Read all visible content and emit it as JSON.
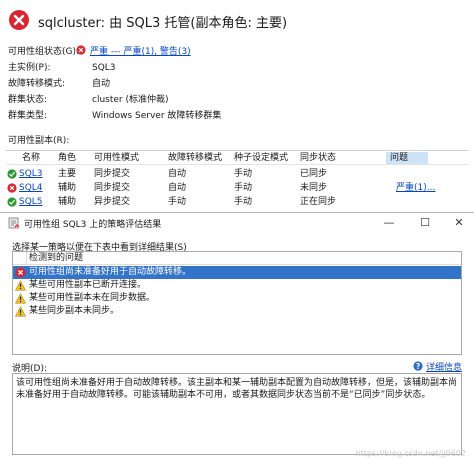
{
  "header": {
    "title": "sqlcluster: 由 SQL3 托管(副本角色: 主要)",
    "icon": "error-icon"
  },
  "properties": [
    {
      "label": "可用性组状态(G):",
      "value": "严重 --- 严重(1), 警告(3)",
      "type": "link-error"
    },
    {
      "label": "主实例(P):",
      "value": "SQL3",
      "type": "text"
    },
    {
      "label": "故障转移模式:",
      "value": "自动",
      "type": "text"
    },
    {
      "label": "群集状态:",
      "value": "cluster (标准仲裁)",
      "type": "text"
    },
    {
      "label": "群集类型:",
      "value": "Windows Server 故障转移群集",
      "type": "text"
    }
  ],
  "replica_caption": "可用性副本(R):",
  "grid": {
    "columns": [
      "名称",
      "角色",
      "可用性模式",
      "故障转移模式",
      "种子设定模式",
      "同步状态",
      "问题"
    ],
    "rows": [
      {
        "name": "SQL3",
        "role": "主要",
        "availability": "同步提交",
        "failover": "自动",
        "seeding": "手动",
        "sync": "已同步",
        "issue": "",
        "status": "ok"
      },
      {
        "name": "SQL4",
        "role": "辅助",
        "availability": "同步提交",
        "failover": "自动",
        "seeding": "手动",
        "sync": "未同步",
        "issue": "严重(1)...",
        "status": "error"
      },
      {
        "name": "SQL5",
        "role": "辅助",
        "availability": "异步提交",
        "failover": "手动",
        "seeding": "手动",
        "sync": "正在同步",
        "issue": "",
        "status": "ok"
      }
    ]
  },
  "dialog": {
    "title": "可用性组 SQL3 上的策略评估结果",
    "minimize": "—",
    "maximize": "☐",
    "close": "✕",
    "policy_caption": "选择某一策略以便在下表中看到详细结果(S)",
    "list_header": "检测到的问题",
    "issues": [
      {
        "text": "可用性组尚未准备好用于自动故障转移。",
        "severity": "error",
        "selected": true
      },
      {
        "text": "某些可用性副本已断开连接。",
        "severity": "warning",
        "selected": false
      },
      {
        "text": "某些可用性副本未在同步数据。",
        "severity": "warning",
        "selected": false
      },
      {
        "text": "某些同步副本未同步。",
        "severity": "warning",
        "selected": false
      }
    ],
    "description_caption": "说明(D):",
    "help_link": "详细信息",
    "description": "该可用性组尚未准备好用于自动故障转移。该主副本和某一辅助副本配置为自动故障转移，但是，该辅助副本尚未准备好用于自动故障转移。可能该辅助副本不可用，或者其数据同步状态当前不是“已同步”同步状态。"
  },
  "watermark": "https://blog.csdn.net/jj0602",
  "colors": {
    "link": "#0645c8",
    "selection": "#3373c8",
    "error": "#d9262f",
    "ok": "#2c9a31",
    "warning": "#f3c320"
  }
}
